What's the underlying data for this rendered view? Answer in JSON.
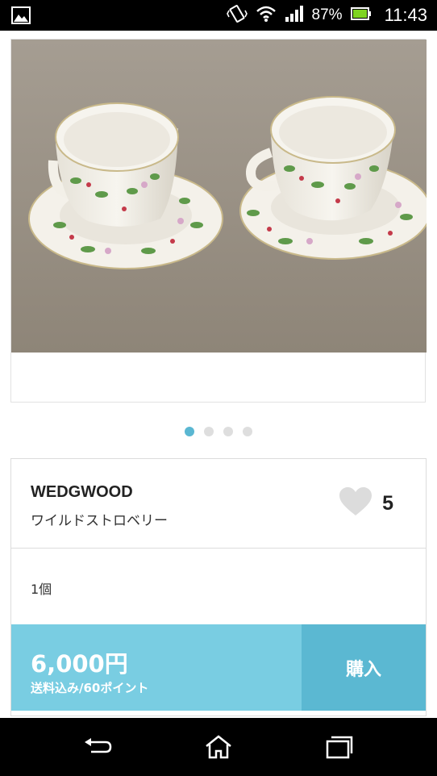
{
  "status_bar": {
    "battery_percent": "87%",
    "time": "11:43",
    "icons": [
      "image-notification-icon",
      "vibrate-icon",
      "wifi-icon",
      "signal-icon",
      "battery-icon"
    ]
  },
  "gallery": {
    "image_alt": "two teacups with saucers, white porcelain with strawberry pattern",
    "page_count": 4,
    "active_index": 0
  },
  "product": {
    "brand": "WEDGWOOD",
    "model": "ワイルドストロベリー",
    "like_count": "5",
    "quantity": "1個",
    "price": "6,000円",
    "price_note": "送料込み/60ポイント",
    "buy_label": "購入"
  },
  "colors": {
    "accent": "#5bb8d2",
    "accent_light": "#79cde2",
    "dot_inactive": "#dedede",
    "heart": "#dcdcdc"
  },
  "navigation": {
    "icons": [
      "back-icon",
      "home-icon",
      "recent-apps-icon"
    ]
  }
}
